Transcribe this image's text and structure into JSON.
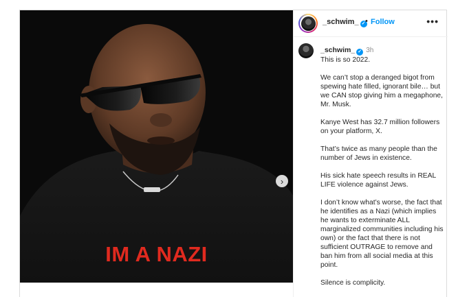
{
  "post": {
    "image_caption": "IM A NAZI",
    "author": {
      "username": "_schwim_",
      "separator": "•",
      "follow_label": "Follow",
      "more_label": "•••"
    },
    "next_label": "›",
    "comment": {
      "username": "_schwim_",
      "time": "3h",
      "paragraphs": [
        "This is so 2022.",
        "We can’t stop a deranged bigot from spewing hate filled, ignorant bile… but we CAN stop giving him a megaphone, Mr. Musk.",
        "Kanye West has 32.7 million followers on your platform, X.",
        "That’s twice as many people than the number of Jews in existence.",
        "His sick hate speech results in REAL LIFE violence against Jews.",
        "I don’t know what’s worse, the fact that he identifies as a Nazi (which implies he wants to exterminate ALL marginalized communities including his own) or the fact that there is not sufficient OUTRAGE to remove and ban him from all social media at this point.",
        "Silence is complicity."
      ]
    }
  },
  "colors": {
    "accent": "#0095f6",
    "slogan": "#e02a1f",
    "photo_bg": "#0a0a0a"
  }
}
